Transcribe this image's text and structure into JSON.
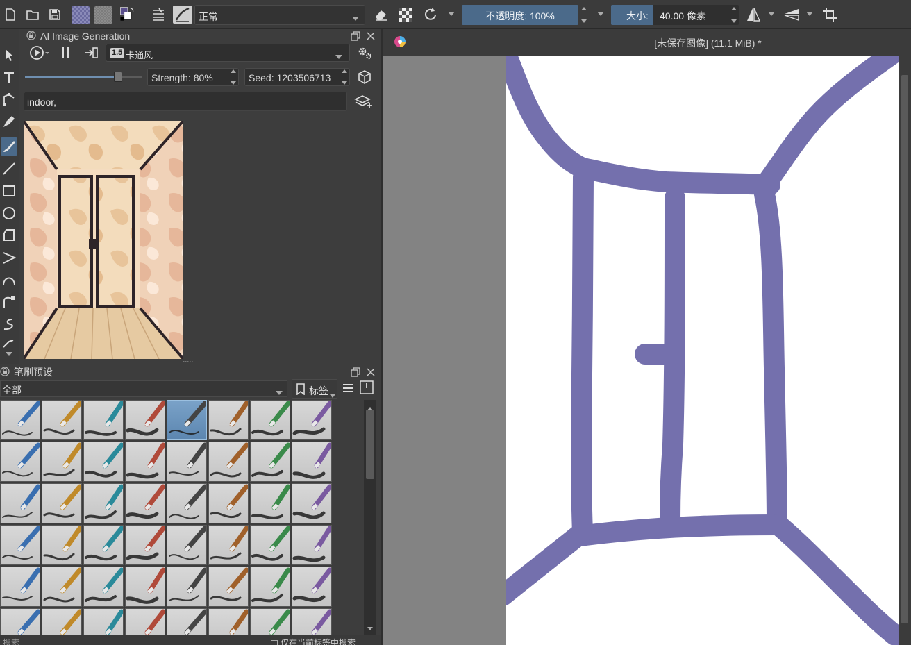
{
  "app": {
    "document_title": "[未保存图像]  (11.1 MiB) *"
  },
  "toolbar": {
    "blend_mode": "正常",
    "opacity_label": "不透明度:  100%",
    "size_label": "大小:",
    "size_value": "40.00 像素",
    "icons": [
      "new-document-icon",
      "open-folder-icon",
      "save-icon",
      "pattern-icon",
      "gradient-icon",
      "color-swap-icon",
      "presets-list-icon",
      "brush-preset-icon",
      "eraser-icon",
      "alpha-lock-icon",
      "reload-icon",
      "mirror-horizontal-icon",
      "mirror-vertical-icon",
      "crop-icon"
    ],
    "colors": {
      "foreground": "#5a4f8c",
      "accent": "#4b6a8a"
    }
  },
  "ai_docker": {
    "title": "AI Image Generation",
    "model_badge": "1.5",
    "model_name": "卡通风",
    "strength_label": "Strength: 80%",
    "strength": 0.8,
    "seed_label": "Seed: 1203506713",
    "prompt": "indoor,"
  },
  "brush_docker": {
    "title": "笔刷预设",
    "tag_filter": "全部",
    "tag_button": "标签",
    "search_placeholder": "搜索",
    "search_current_only": "仅在当前标签中搜索"
  },
  "canvas": {
    "stroke_color": "#7470ad",
    "background": "#ffffff"
  }
}
